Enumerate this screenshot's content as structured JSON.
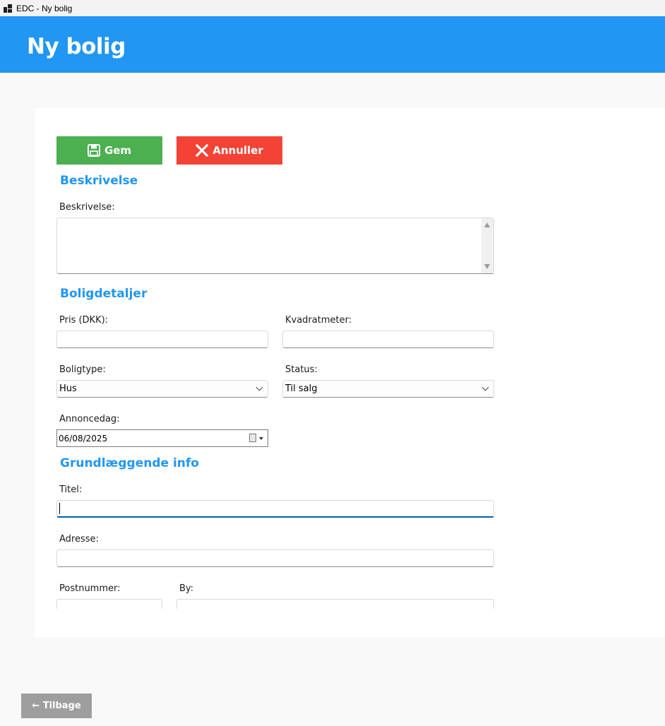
{
  "window": {
    "title": "EDC - Ny bolig"
  },
  "header": {
    "title": "Ny bolig"
  },
  "toolbar": {
    "save_label": "Gem",
    "cancel_label": "Annuller",
    "save_color": "#4caf50",
    "cancel_color": "#f44336"
  },
  "sections": {
    "description": "Beskrivelse",
    "details": "Boligdetaljer",
    "basic": "Grundlæggende info"
  },
  "fields": {
    "description": {
      "label": "Beskrivelse:",
      "value": ""
    },
    "price": {
      "label": "Pris (DKK):",
      "value": ""
    },
    "sqm": {
      "label": "Kvadratmeter:",
      "value": ""
    },
    "type": {
      "label": "Boligtype:",
      "value": "Hus"
    },
    "status": {
      "label": "Status:",
      "value": "Til salg"
    },
    "listing_date": {
      "label": "Annoncedag:",
      "value": "06/08/2025"
    },
    "title": {
      "label": "Titel:",
      "value": ""
    },
    "address": {
      "label": "Adresse:",
      "value": ""
    },
    "postal": {
      "label": "Postnummer:",
      "value": ""
    },
    "city": {
      "label": "By:",
      "value": ""
    }
  },
  "footer": {
    "back_label": "← Tilbage"
  },
  "colors": {
    "accent": "#2196f3",
    "back": "#9e9e9e"
  }
}
